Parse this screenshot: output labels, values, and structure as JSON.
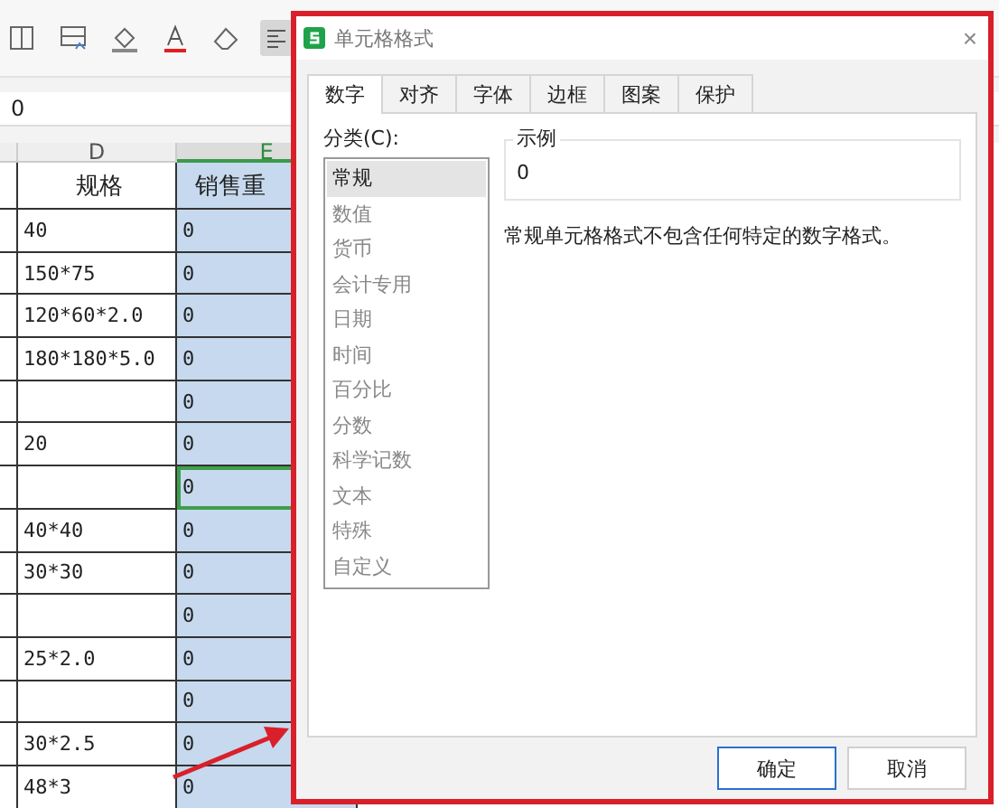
{
  "formula_bar": {
    "value": "0"
  },
  "columns": [
    {
      "label": "D",
      "selected": false
    },
    {
      "label": "E",
      "selected": true
    }
  ],
  "header_row": {
    "d": "规格",
    "e": "销售重"
  },
  "rows": [
    {
      "d": "40",
      "e": "0",
      "selected": false
    },
    {
      "d": "150*75",
      "e": "0",
      "selected": false
    },
    {
      "d": "120*60*2.0",
      "e": "0",
      "selected": false
    },
    {
      "d": "180*180*5.0",
      "e": "0",
      "selected": false
    },
    {
      "d": "",
      "e": "0",
      "selected": false
    },
    {
      "d": "20",
      "e": "0",
      "selected": false
    },
    {
      "d": "",
      "e": "0",
      "selected": true
    },
    {
      "d": "40*40",
      "e": "0",
      "selected": false
    },
    {
      "d": "30*30",
      "e": "0",
      "selected": false
    },
    {
      "d": "",
      "e": "0",
      "selected": false
    },
    {
      "d": "25*2.0",
      "e": "0",
      "selected": false
    },
    {
      "d": "",
      "e": "0",
      "selected": false
    },
    {
      "d": "30*2.5",
      "e": "0",
      "selected": false
    },
    {
      "d": "48*3",
      "e": "0",
      "selected": false
    }
  ],
  "dialog": {
    "title": "单元格格式",
    "close": "×",
    "tabs": [
      {
        "label": "数字",
        "selected": true
      },
      {
        "label": "对齐",
        "selected": false
      },
      {
        "label": "字体",
        "selected": false
      },
      {
        "label": "边框",
        "selected": false
      },
      {
        "label": "图案",
        "selected": false
      },
      {
        "label": "保护",
        "selected": false
      }
    ],
    "category_label": "分类(C):",
    "categories": [
      {
        "label": "常规",
        "selected": true
      },
      {
        "label": "数值",
        "selected": false
      },
      {
        "label": "货币",
        "selected": false
      },
      {
        "label": "会计专用",
        "selected": false
      },
      {
        "label": "日期",
        "selected": false
      },
      {
        "label": "时间",
        "selected": false
      },
      {
        "label": "百分比",
        "selected": false
      },
      {
        "label": "分数",
        "selected": false
      },
      {
        "label": "科学记数",
        "selected": false
      },
      {
        "label": "文本",
        "selected": false
      },
      {
        "label": "特殊",
        "selected": false
      },
      {
        "label": "自定义",
        "selected": false
      }
    ],
    "sample": {
      "legend": "示例",
      "value": "0"
    },
    "description": "常规单元格格式不包含任何特定的数字格式。",
    "buttons": [
      {
        "label": "确定",
        "kind": "primary"
      },
      {
        "label": "取消",
        "kind": "secondary"
      }
    ]
  }
}
